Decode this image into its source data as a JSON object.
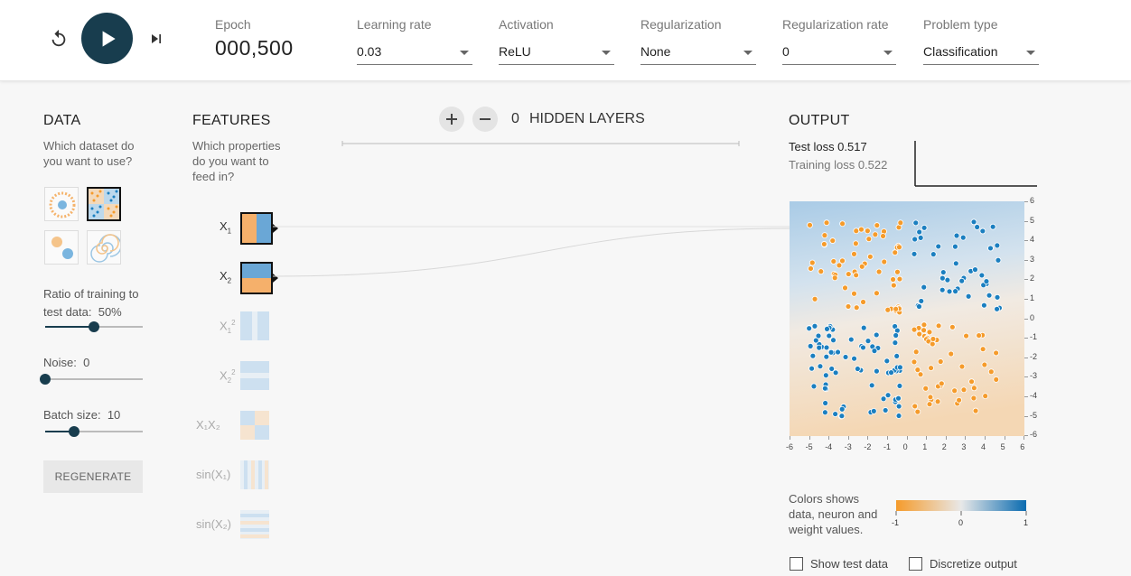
{
  "controls": {
    "epoch_label": "Epoch",
    "epoch_value": "000,500",
    "learning_rate": {
      "label": "Learning rate",
      "value": "0.03"
    },
    "activation": {
      "label": "Activation",
      "value": "ReLU"
    },
    "regularization": {
      "label": "Regularization",
      "value": "None"
    },
    "regularization_rate": {
      "label": "Regularization rate",
      "value": "0"
    },
    "problem_type": {
      "label": "Problem type",
      "value": "Classification"
    }
  },
  "data_panel": {
    "title": "DATA",
    "question": "Which dataset do you want to use?",
    "selected_dataset": "xor",
    "ratio_label": "Ratio of training to test data:",
    "ratio_value": "50%",
    "ratio_level": 0.5,
    "noise_label": "Noise:",
    "noise_value": "0",
    "noise_level": 0,
    "batch_label": "Batch size:",
    "batch_value": "10",
    "batch_level": 0.3,
    "regenerate_label": "REGENERATE"
  },
  "features_panel": {
    "title": "FEATURES",
    "question": "Which properties do you want to feed in?",
    "features": [
      {
        "base": "X",
        "sub": "1",
        "sup": "",
        "active": true
      },
      {
        "base": "X",
        "sub": "2",
        "sup": "",
        "active": true
      },
      {
        "base": "X",
        "sub": "1",
        "sup": "2",
        "active": false
      },
      {
        "base": "X",
        "sub": "2",
        "sup": "2",
        "active": false
      },
      {
        "base": "X₁X₂",
        "sub": "",
        "sup": "",
        "active": false
      },
      {
        "base": "sin(X₁)",
        "sub": "",
        "sup": "",
        "active": false
      },
      {
        "base": "sin(X₂)",
        "sub": "",
        "sup": "",
        "active": false
      }
    ]
  },
  "network": {
    "hidden_count": "0",
    "hidden_label": "HIDDEN LAYERS",
    "add_icon": "plus-icon",
    "remove_icon": "minus-icon"
  },
  "output_panel": {
    "title": "OUTPUT",
    "test_loss": "Test loss 0.517",
    "training_loss": "Training loss 0.522",
    "y_ticks": [
      "6",
      "5",
      "4",
      "3",
      "2",
      "1",
      "0",
      "-1",
      "-2",
      "-3",
      "-4",
      "-5",
      "-6"
    ],
    "x_ticks": [
      "-6",
      "-5",
      "-4",
      "-3",
      "-2",
      "-1",
      "0",
      "1",
      "2",
      "3",
      "4",
      "5",
      "6"
    ],
    "legend_text": "Colors shows data, neuron and weight values.",
    "legend_ticks": [
      "-1",
      "0",
      "1"
    ],
    "show_test_data": "Show test data",
    "discretize_output": "Discretize output"
  },
  "colors": {
    "orange": "#f59b2b",
    "blue": "#1b7fc0",
    "dark": "#183d4e"
  }
}
